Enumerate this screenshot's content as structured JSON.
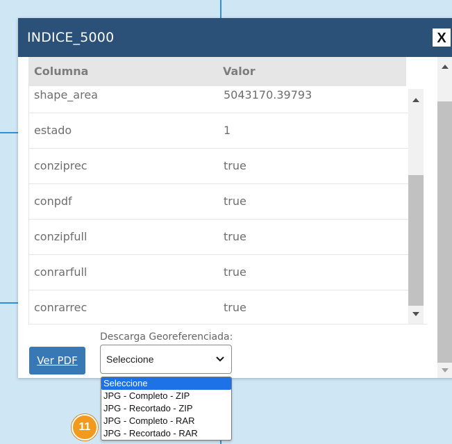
{
  "popup": {
    "title": "INDICE_5000",
    "close_label": "X"
  },
  "table": {
    "headers": {
      "column": "Columna",
      "value": "Valor"
    },
    "rows": [
      {
        "column": "shape_area",
        "value": "5043170.39793"
      },
      {
        "column": "estado",
        "value": "1"
      },
      {
        "column": "conziprec",
        "value": "true"
      },
      {
        "column": "conpdf",
        "value": "true"
      },
      {
        "column": "conzipfull",
        "value": "true"
      },
      {
        "column": "conrarfull",
        "value": "true"
      },
      {
        "column": "conrarrec",
        "value": "true"
      }
    ]
  },
  "download": {
    "label": "Descarga Georeferenciada:",
    "pdf_button": "Ver PDF",
    "selected": "Seleccione",
    "options": [
      "Seleccione",
      "JPG - Completo - ZIP",
      "JPG - Recortado - ZIP",
      "JPG - Completo - RAR",
      "JPG - Recortado - RAR"
    ]
  },
  "step_badge": "11",
  "icons": {
    "close": "close-icon",
    "dropdown": "chevron-down-icon",
    "scroll_up": "arrow-up-icon",
    "scroll_down": "arrow-down-icon"
  },
  "colors": {
    "header": "#2b5179",
    "button": "#3878b4",
    "selected_option": "#1e72e8",
    "badge": "#f29a1b",
    "map": "#cfe6f5"
  }
}
